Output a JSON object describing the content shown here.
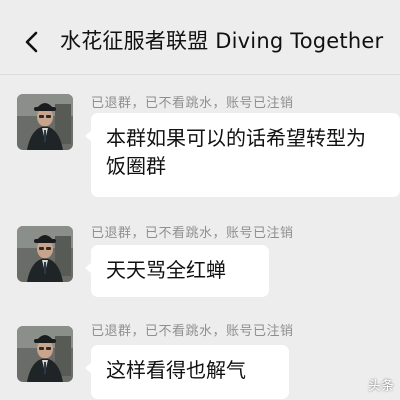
{
  "header": {
    "title": "水花征服者联盟 Diving Together",
    "back_icon": "chevron-left-icon"
  },
  "messages": [
    {
      "sender": "已退群，已不看跳水，账号已注销",
      "text_lines": [
        "本群如果可以的话希望转型为",
        "饭圈群"
      ]
    },
    {
      "sender": "已退群，已不看跳水，账号已注销",
      "text_lines": [
        "天天骂全红蝉"
      ]
    },
    {
      "sender": "已退群，已不看跳水，账号已注销",
      "text_lines": [
        "这样看得也解气"
      ]
    }
  ],
  "watermark": "头条",
  "colors": {
    "background": "#ededed",
    "bubble": "#ffffff",
    "sender_text": "#8f8f8f",
    "message_text": "#111111"
  }
}
